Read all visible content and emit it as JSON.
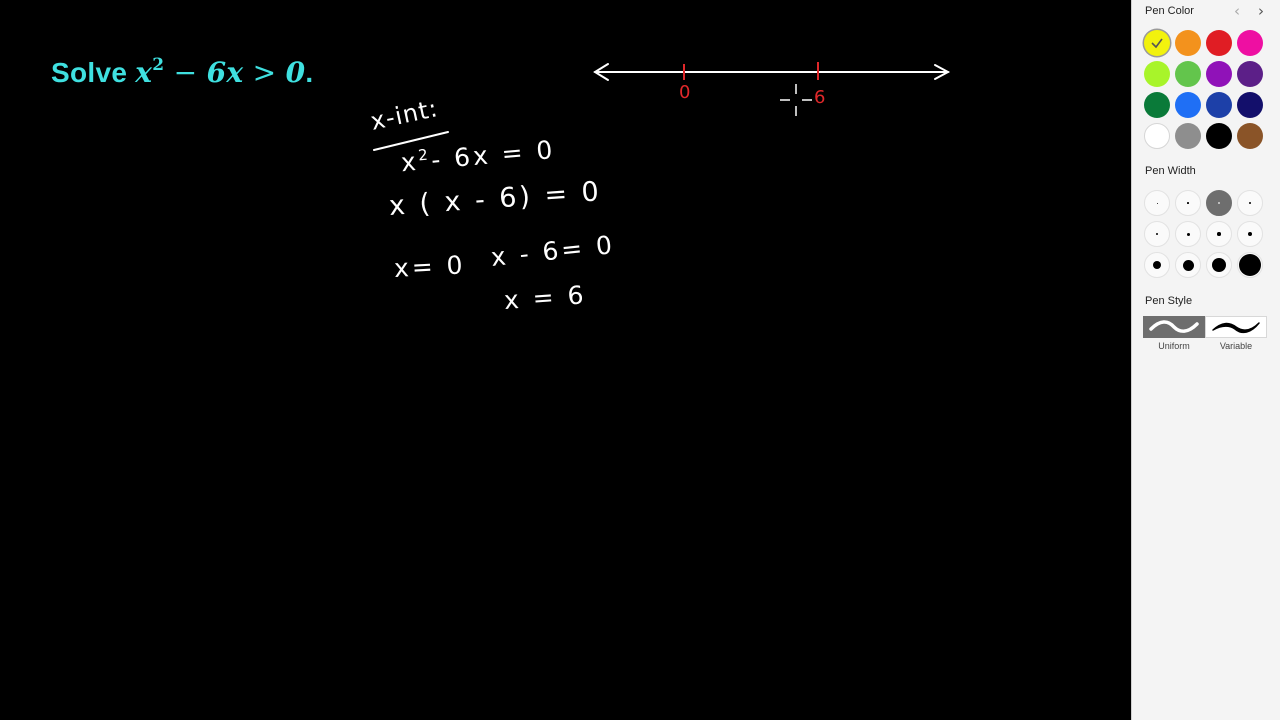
{
  "problem": {
    "prefix": "Solve ",
    "base": "x",
    "exponent": "2",
    "minus": " − ",
    "term": "6x",
    "relation": " > ",
    "rhs": "0",
    "period": ".",
    "color": "#3fe0e0"
  },
  "number_line": {
    "labels": [
      "0",
      "6"
    ],
    "label_color": "#e0282a"
  },
  "handwriting": {
    "heading": "x-int:",
    "line1_base": "x",
    "line1_exp": "2",
    "line1_rest": "- 6x = 0",
    "line2": "x ( x - 6) = 0",
    "line3a": "x= 0",
    "line3b": "x - 6= 0",
    "line4": "x = 6"
  },
  "panel": {
    "pen_color_title": "Pen Color",
    "pen_width_title": "Pen Width",
    "pen_style_title": "Pen Style",
    "nav_prev_icon": "chevron-left-icon",
    "nav_next_icon": "chevron-right-icon",
    "nav_prev": "‹",
    "nav_next": "›",
    "colors": [
      "#f2f20d",
      "#f3921d",
      "#e01d24",
      "#ee0fa2",
      "#a8f42a",
      "#63c54c",
      "#9012b8",
      "#5c1f88",
      "#0a7a39",
      "#1f6ff5",
      "#1d40a8",
      "#130f6b",
      "#ffffff",
      "#8e8e8e",
      "#000000",
      "#8a5428"
    ],
    "selected_color_index": 0,
    "widths": [
      1,
      1.5,
      2,
      2,
      2.5,
      3,
      3.5,
      4,
      8,
      11,
      14,
      22
    ],
    "selected_width_index": 2,
    "styles": [
      {
        "label": "Uniform",
        "selected": true
      },
      {
        "label": "Variable",
        "selected": false
      }
    ]
  }
}
